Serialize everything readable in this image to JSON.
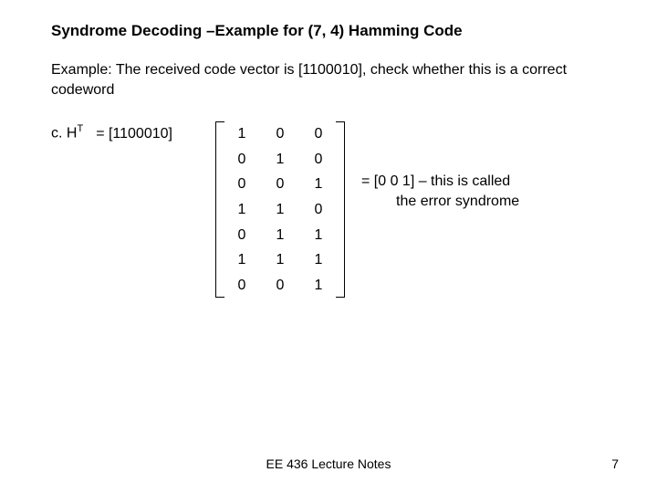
{
  "title": "Syndrome Decoding –Example for (7, 4) Hamming Code",
  "example_text": "Example: The received code vector is [1100010], check whether this is a correct codeword",
  "equation": {
    "lhs": "c. H",
    "lhs_sup": "T",
    "eq_vector": "= [1100010]"
  },
  "matrix": [
    [
      "1",
      "0",
      "0"
    ],
    [
      "0",
      "1",
      "0"
    ],
    [
      "0",
      "0",
      "1"
    ],
    [
      "1",
      "1",
      "0"
    ],
    [
      "0",
      "1",
      "1"
    ],
    [
      "1",
      "1",
      "1"
    ],
    [
      "0",
      "0",
      "1"
    ]
  ],
  "result": {
    "line1": "= [0 0 1] – this is called",
    "line2": "the error syndrome"
  },
  "footer": "EE 436 Lecture Notes",
  "page": "7"
}
